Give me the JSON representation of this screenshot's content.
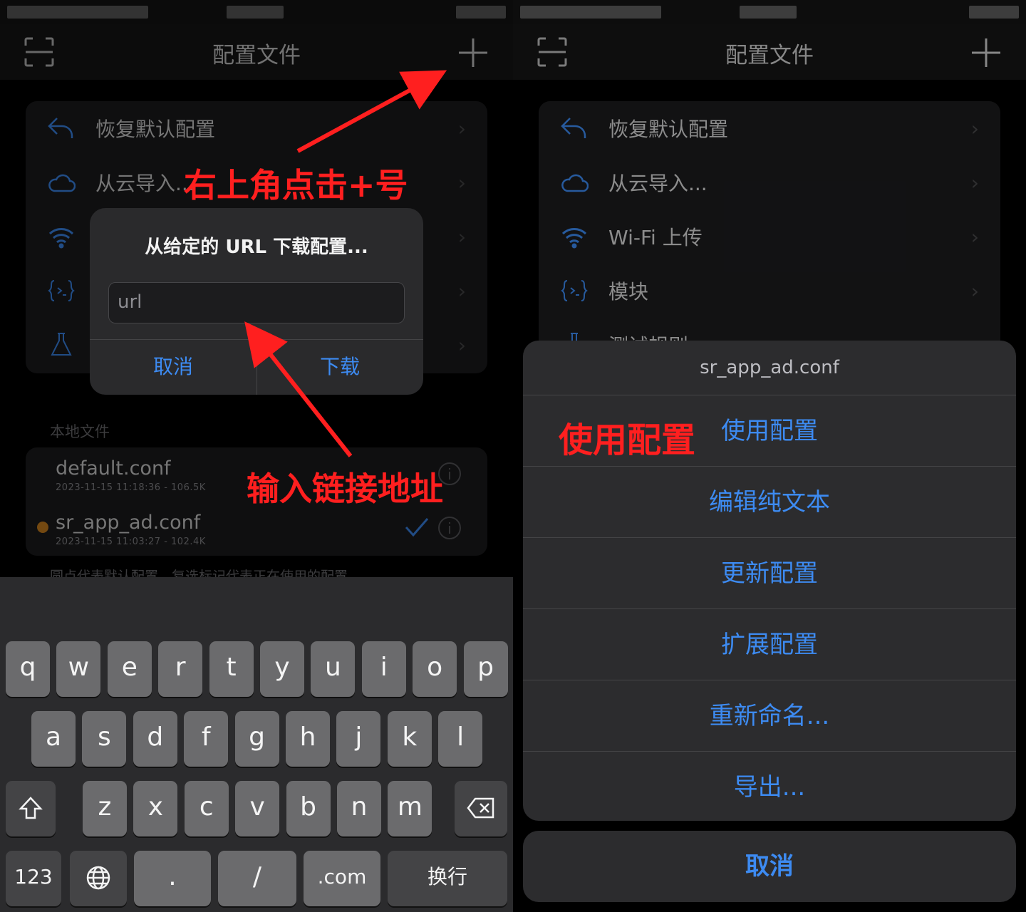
{
  "left": {
    "nav": {
      "title": "配置文件"
    },
    "menu": [
      {
        "label": "恢复默认配置"
      },
      {
        "label": "从云导入..."
      }
    ],
    "alert": {
      "title": "从给定的 URL 下载配置...",
      "input_placeholder": "url",
      "cancel": "取消",
      "download": "下载"
    },
    "local": {
      "header": "本地文件",
      "files": [
        {
          "name": "default.conf",
          "meta": "2023-11-15 11:18:36 - 106.5K"
        },
        {
          "name": "sr_app_ad.conf",
          "meta": "2023-11-15 11:03:27 - 102.4K"
        }
      ],
      "footnote": "圆点代表默认配置，复选标记代表正在使用的配置"
    },
    "keyboard": {
      "row1": [
        "q",
        "w",
        "e",
        "r",
        "t",
        "y",
        "u",
        "i",
        "o",
        "p"
      ],
      "row2": [
        "a",
        "s",
        "d",
        "f",
        "g",
        "h",
        "j",
        "k",
        "l"
      ],
      "row3": [
        "z",
        "x",
        "c",
        "v",
        "b",
        "n",
        "m"
      ],
      "numbers": "123",
      "dot": ".",
      "slash": "/",
      "dotcom": ".com",
      "return": "换行"
    },
    "annotations": {
      "top": "右上角点击+号",
      "bottom": "输入链接地址"
    },
    "colors": {
      "accent": "#3d8bf2",
      "annotation": "#ff1f1f",
      "default_dot": "#d4861f"
    }
  },
  "right": {
    "nav": {
      "title": "配置文件"
    },
    "menu": [
      {
        "label": "恢复默认配置"
      },
      {
        "label": "从云导入..."
      },
      {
        "label": "Wi-Fi 上传"
      },
      {
        "label": "模块"
      },
      {
        "label": "测试规则"
      }
    ],
    "sheet": {
      "title": "sr_app_ad.conf",
      "actions": [
        "使用配置",
        "编辑纯文本",
        "更新配置",
        "扩展配置",
        "重新命名...",
        "导出..."
      ],
      "cancel": "取消"
    },
    "annotation": "使用配置"
  }
}
